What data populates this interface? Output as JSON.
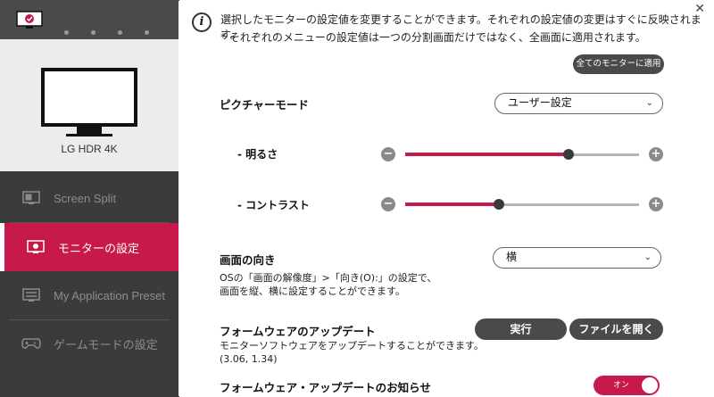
{
  "sidebar": {
    "monitor_model": "LG HDR 4K",
    "nav": [
      {
        "label": "Screen Split",
        "icon": "screen-split-icon"
      },
      {
        "label": "モニターの設定",
        "icon": "monitor-settings-icon"
      },
      {
        "label": "My Application Preset",
        "icon": "keyboard-icon"
      },
      {
        "label": "ゲームモードの設定",
        "icon": "gamepad-icon"
      }
    ],
    "active_index": 1
  },
  "main": {
    "info_line1": "選択したモニターの設定値を変更することができます。それぞれの設定値の変更はすぐに反映されます。",
    "info_line2": "* それぞれのメニューの設定値は一つの分割画面だけではなく、全画面に適用されます。",
    "apply_all_label": "全てのモニターに適用",
    "picture_mode": {
      "label": "ピクチャーモード",
      "value": "ユーザー設定"
    },
    "brightness": {
      "label": "- 明るさ",
      "level": 0.7
    },
    "contrast": {
      "label": "- コントラスト",
      "level": 0.4
    },
    "orientation": {
      "label": "画面の向き",
      "value": "横",
      "desc1": "OSの「画面の解像度」>「向き(O):」の設定で、",
      "desc2": "画面を縦、横に設定することができます。"
    },
    "firmware": {
      "label": "フォームウェアのアップデート",
      "desc": "モニターソフトウェアをアップデートすることができます。",
      "version": "(3.06, 1.34)",
      "run_label": "実行",
      "open_file_label": "ファイルを開く"
    },
    "firmware_notice": {
      "label": "フォームウェア・アップデートのお知らせ",
      "toggle_label": "オン"
    }
  },
  "colors": {
    "accent": "#c8194b",
    "sidebar_bg": "#3b3b3b"
  }
}
